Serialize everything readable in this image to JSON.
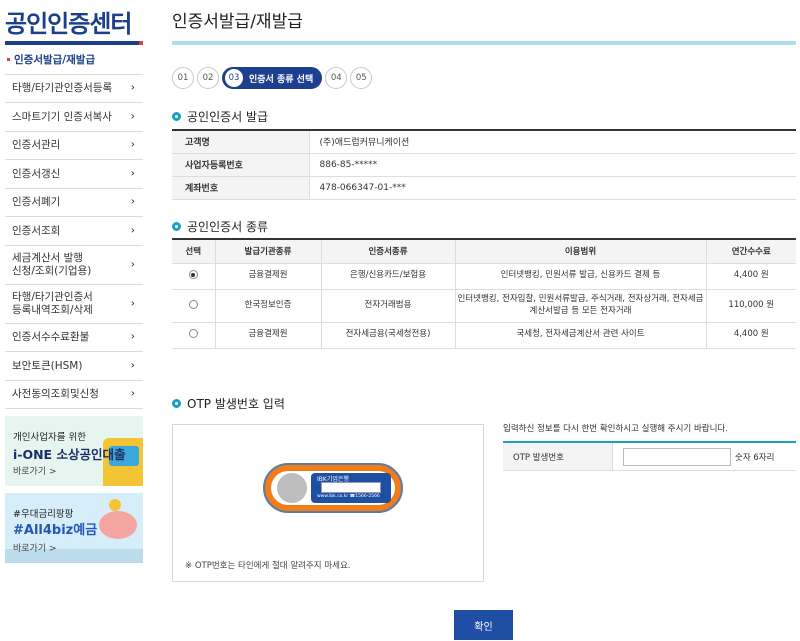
{
  "sidebar": {
    "title": "공인인증센터",
    "items": [
      {
        "label": "인증서발급/재발급"
      },
      {
        "label": "타행/타기관인증서등록"
      },
      {
        "label": "스마트기기 인증서복사"
      },
      {
        "label": "인증서관리"
      },
      {
        "label": "인증서갱신"
      },
      {
        "label": "인증서폐기"
      },
      {
        "label": "인증서조회"
      },
      {
        "label": "세금계산서 발행\n신청/조회(기업용)"
      },
      {
        "label": "타행/타기관인증서\n등록내역조회/삭제"
      },
      {
        "label": "인증서수수료환불"
      },
      {
        "label": "보안토큰(HSM)"
      },
      {
        "label": "사전동의조회및신청"
      }
    ],
    "chevron": "›",
    "banners": [
      {
        "small": "개인사업자를 위한",
        "big": "i-ONE 소상공인대출",
        "link": "바로가기 >"
      },
      {
        "small": "#우대금리팡팡",
        "big": "#All4biz예금",
        "link": "바로가기 >"
      }
    ]
  },
  "page": {
    "title": "인증서발급/재발급"
  },
  "steps": [
    {
      "num": "01"
    },
    {
      "num": "02"
    },
    {
      "num": "03",
      "label": "인증서 종류 선택"
    },
    {
      "num": "04"
    },
    {
      "num": "05"
    }
  ],
  "issue_section": {
    "heading": "공인인증서 발급",
    "rows": [
      {
        "label": "고객명",
        "value": "(주)애드럽커뮤니케이션"
      },
      {
        "label": "사업자등록번호",
        "value": "886-85-*****"
      },
      {
        "label": "계좌번호",
        "value": "478-066347-01-***"
      }
    ]
  },
  "type_section": {
    "heading": "공인인증서 종류",
    "columns": [
      "선택",
      "발급기관종류",
      "인증서종류",
      "이용범위",
      "연간수수료"
    ],
    "rows": [
      {
        "selected": true,
        "org": "금융결제원",
        "type": "은행/신용카드/보험용",
        "scope": "인터넷뱅킹, 민원서류 발급, 신용카드 결제 등",
        "fee": "4,400 원"
      },
      {
        "selected": false,
        "org": "한국정보인증",
        "type": "전자거래범용",
        "scope": "인터넷뱅킹, 전자입찰, 민원서류발급, 주식거래, 전자상거래, 전자세금계산서발급 등 모든 전자거래",
        "fee": "110,000 원"
      },
      {
        "selected": false,
        "org": "금융결제원",
        "type": "전자세금용(국세청전용)",
        "scope": "국세청, 전자세금계산서 관련 사이트",
        "fee": "4,400 원"
      }
    ]
  },
  "otp_section": {
    "heading": "OTP 발생번호 입력",
    "token_brand": "IBK기업은행",
    "token_url": "www.ibk.co.kr ☎1566-2566",
    "note": "※ OTP번호는 타인에게 절대 알려주지 마세요.",
    "instruction": "입력하신 정보를 다시 한번 확인하시고 실행해 주시기 바랍니다.",
    "field_label": "OTP 발생번호",
    "field_value": "",
    "field_hint": "숫자 6자리"
  },
  "confirm_label": "확인",
  "colors": {
    "primary": "#1c3f8c",
    "accent": "#1aa0c6",
    "title_bar": "#a9e1ea",
    "button": "#1e4fa5",
    "token_orange": "#f07d18"
  }
}
